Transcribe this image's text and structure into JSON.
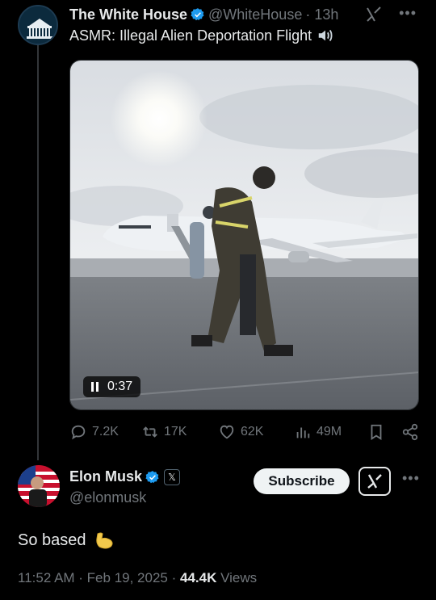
{
  "post": {
    "author_name": "The White House",
    "author_handle": "@WhiteHouse",
    "time_ago": "· 13h",
    "text": "ASMR: Illegal Alien Deportation Flight",
    "video_time": "0:37",
    "actions": {
      "replies": "7.2K",
      "reposts": "17K",
      "likes": "62K",
      "views": "49M"
    }
  },
  "reply": {
    "author_name": "Elon Musk",
    "author_handle": "@elonmusk",
    "badge": "𝕏",
    "subscribe_label": "Subscribe",
    "text": "So based",
    "time": "11:52 AM · Feb 19, 2025 · ",
    "views_count": "44.4K",
    "views_label": " Views"
  },
  "colors": {
    "background": "#000000",
    "text_primary": "#e7e9ea",
    "text_secondary": "#71767b",
    "verified_blue": "#1d9bf0"
  },
  "icons": [
    "verified-icon",
    "grok-icon",
    "more-icon",
    "speaker-icon",
    "pause-icon",
    "reply-icon",
    "repost-icon",
    "like-icon",
    "views-icon",
    "bookmark-icon",
    "share-icon",
    "muscle-emoji-icon"
  ]
}
